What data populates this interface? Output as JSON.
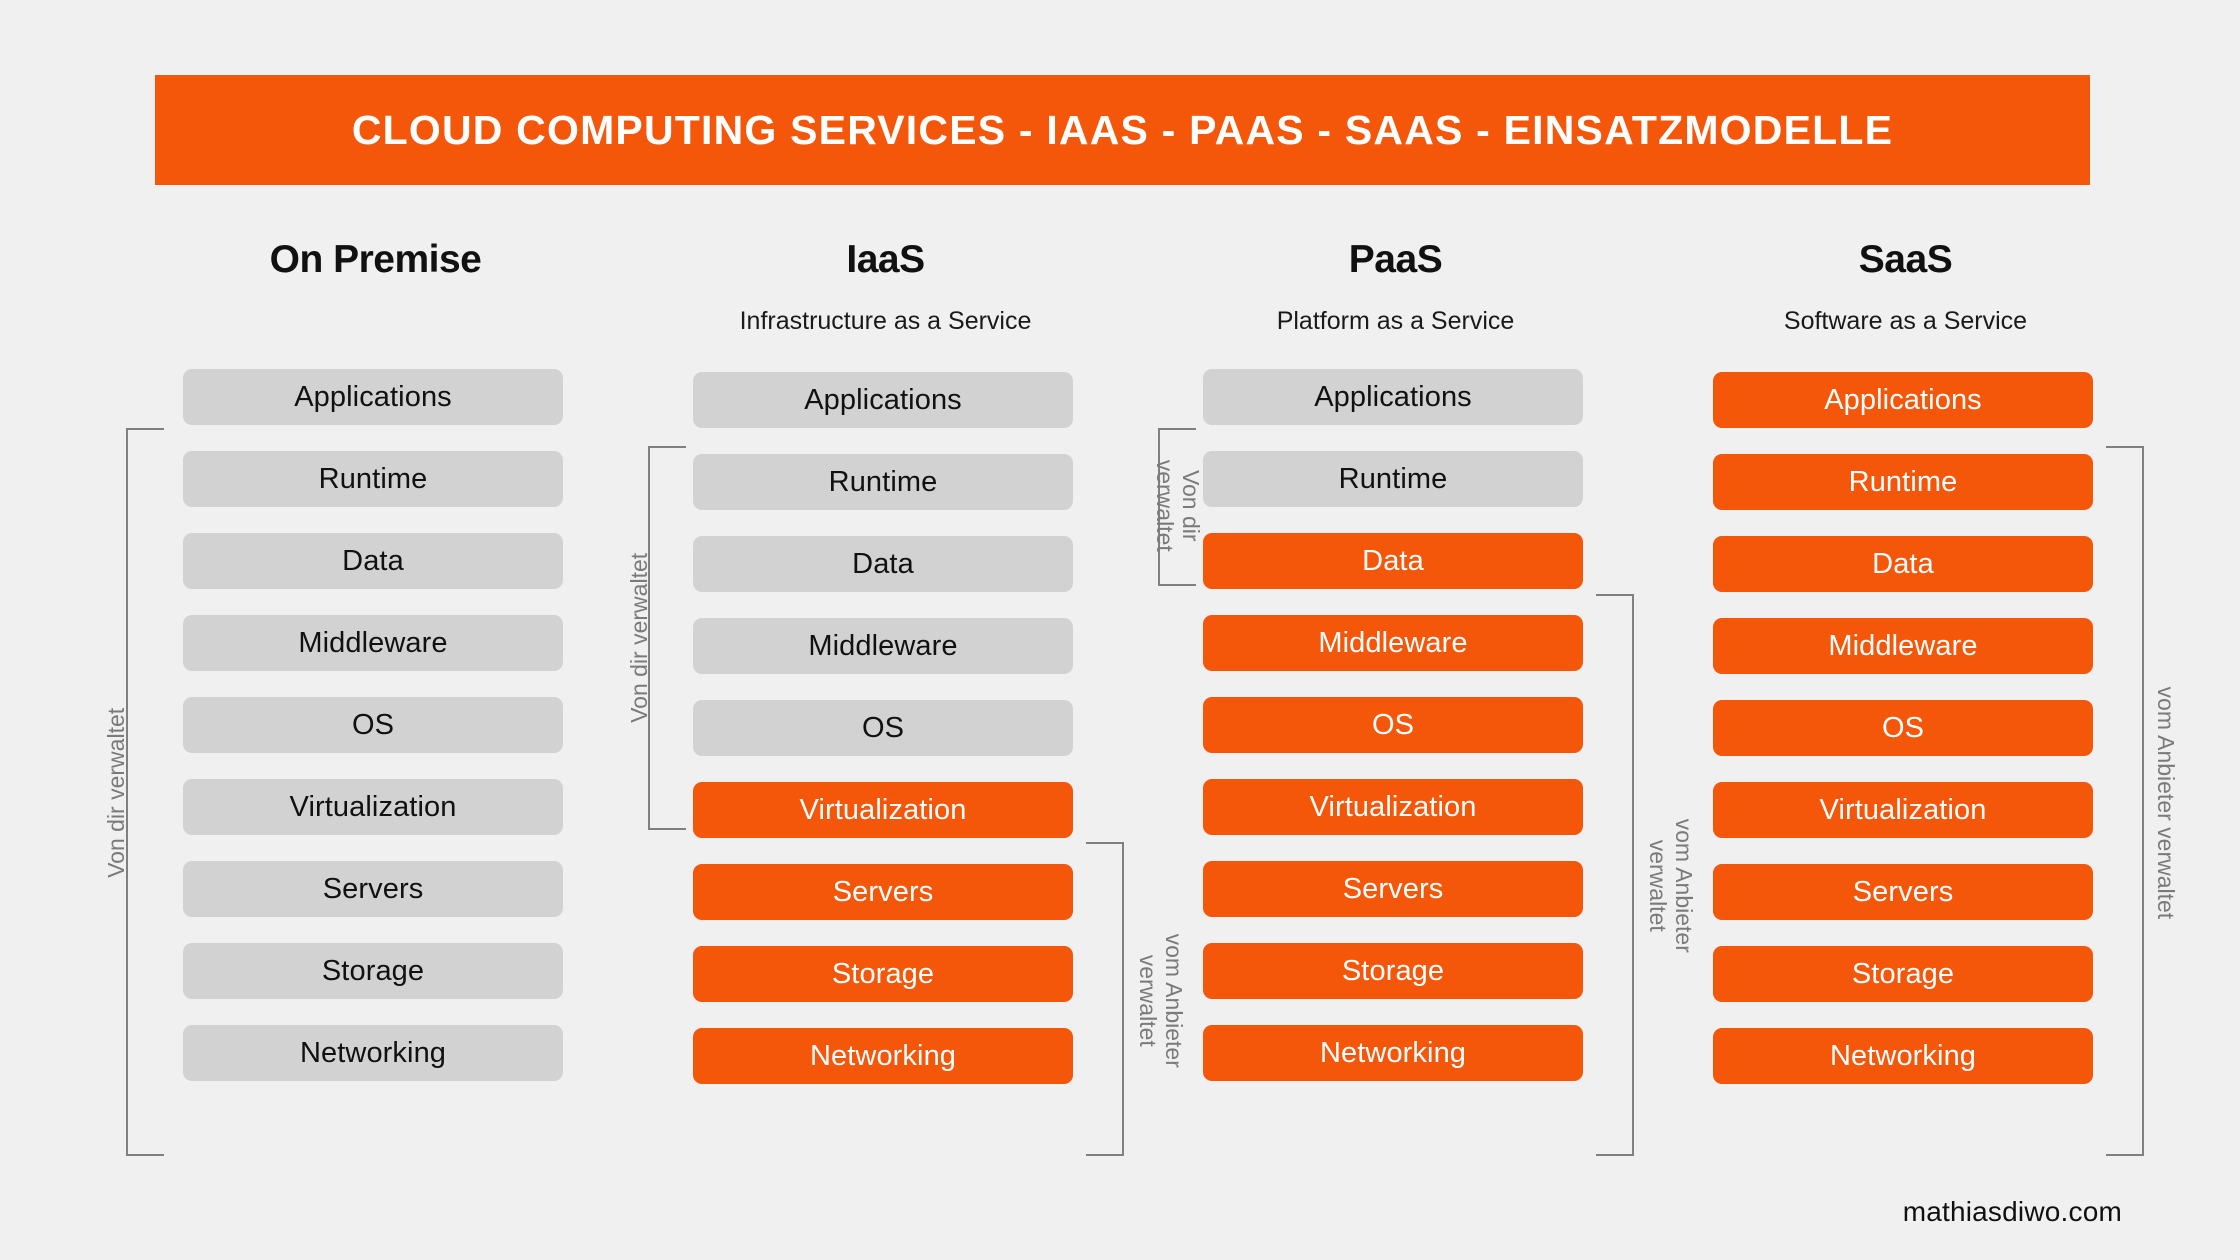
{
  "title": "CLOUD COMPUTING SERVICES - IAAS - PAAS - SAAS - EINSATZMODELLE",
  "footer": "mathiasdiwo.com",
  "colors": {
    "accent_orange": "#F4570A",
    "bar_gray": "#D2D2D2",
    "background": "#F0F0F0",
    "bracket_gray": "#808080",
    "label_gray": "#7A7A7A"
  },
  "labels": {
    "managed_by_you": "Von dir verwaltet",
    "managed_by_you_l1": "Von dir",
    "managed_by_you_l2": "verwaltet",
    "managed_by_provider": "vom Anbieter verwaltet",
    "managed_by_provider_l1": "vom Anbieter",
    "managed_by_provider_l2": "verwaltet"
  },
  "columns": [
    {
      "key": "on-premise",
      "title": "On Premise",
      "subtitle": "",
      "layers": [
        {
          "label": "Applications",
          "owner": "self"
        },
        {
          "label": "Runtime",
          "owner": "self"
        },
        {
          "label": "Data",
          "owner": "self"
        },
        {
          "label": "Middleware",
          "owner": "self"
        },
        {
          "label": "OS",
          "owner": "self"
        },
        {
          "label": "Virtualization",
          "owner": "self"
        },
        {
          "label": "Servers",
          "owner": "self"
        },
        {
          "label": "Storage",
          "owner": "self"
        },
        {
          "label": "Networking",
          "owner": "self"
        }
      ]
    },
    {
      "key": "iaas",
      "title": "IaaS",
      "subtitle": "Infrastructure as a Service",
      "layers": [
        {
          "label": "Applications",
          "owner": "self"
        },
        {
          "label": "Runtime",
          "owner": "self"
        },
        {
          "label": "Data",
          "owner": "self"
        },
        {
          "label": "Middleware",
          "owner": "self"
        },
        {
          "label": "OS",
          "owner": "self"
        },
        {
          "label": "Virtualization",
          "owner": "provider"
        },
        {
          "label": "Servers",
          "owner": "provider"
        },
        {
          "label": "Storage",
          "owner": "provider"
        },
        {
          "label": "Networking",
          "owner": "provider"
        }
      ]
    },
    {
      "key": "paas",
      "title": "PaaS",
      "subtitle": "Platform as a Service",
      "layers": [
        {
          "label": "Applications",
          "owner": "self"
        },
        {
          "label": "Runtime",
          "owner": "self"
        },
        {
          "label": "Data",
          "owner": "provider"
        },
        {
          "label": "Middleware",
          "owner": "provider"
        },
        {
          "label": "OS",
          "owner": "provider"
        },
        {
          "label": "Virtualization",
          "owner": "provider"
        },
        {
          "label": "Servers",
          "owner": "provider"
        },
        {
          "label": "Storage",
          "owner": "provider"
        },
        {
          "label": "Networking",
          "owner": "provider"
        }
      ]
    },
    {
      "key": "saas",
      "title": "SaaS",
      "subtitle": "Software as a Service",
      "layers": [
        {
          "label": "Applications",
          "owner": "provider"
        },
        {
          "label": "Runtime",
          "owner": "provider"
        },
        {
          "label": "Data",
          "owner": "provider"
        },
        {
          "label": "Middleware",
          "owner": "provider"
        },
        {
          "label": "OS",
          "owner": "provider"
        },
        {
          "label": "Virtualization",
          "owner": "provider"
        },
        {
          "label": "Servers",
          "owner": "provider"
        },
        {
          "label": "Storage",
          "owner": "provider"
        },
        {
          "label": "Networking",
          "owner": "provider"
        }
      ]
    }
  ]
}
